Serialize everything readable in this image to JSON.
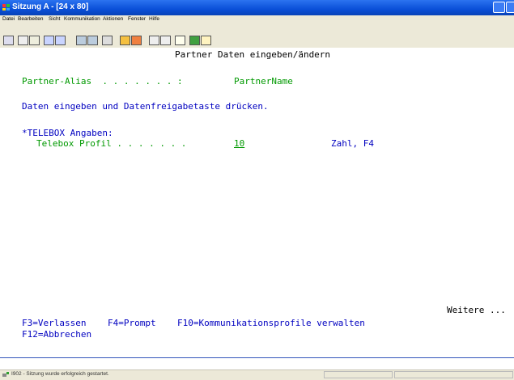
{
  "window": {
    "title": "Sitzung A - [24 x 80]"
  },
  "menu": [
    "Datei",
    "Bearbeiten",
    "Sicht",
    "Kommunikation",
    "Aktionen",
    "Fenster",
    "Hilfe"
  ],
  "screen": {
    "heading": "Partner Daten eingeben/ändern",
    "alias_label": "Partner-Alias  . . . . . . . :",
    "alias_value": "PartnerName",
    "instruction": "Daten eingeben und Datenfreigabetaste drücken.",
    "section": "*TELEBOX Angaben:",
    "profile_label": "Telebox Profil . . . . . . .",
    "profile_value": "10",
    "profile_hint": "Zahl, F4",
    "more": "Weitere ...",
    "fkeys_line1": "F3=Verlassen    F4=Prompt    F10=Kommunikationsprofile verwalten",
    "fkeys_line2": "F12=Abbrechen"
  },
  "status": {
    "message": "I902 - Sitzung wurde erfolgreich gestartet."
  },
  "colors": {
    "titlebar": "#0a4fd8",
    "terminal_bg": "#ffffff",
    "field_green": "#009900",
    "text_blue": "#0000c0"
  }
}
